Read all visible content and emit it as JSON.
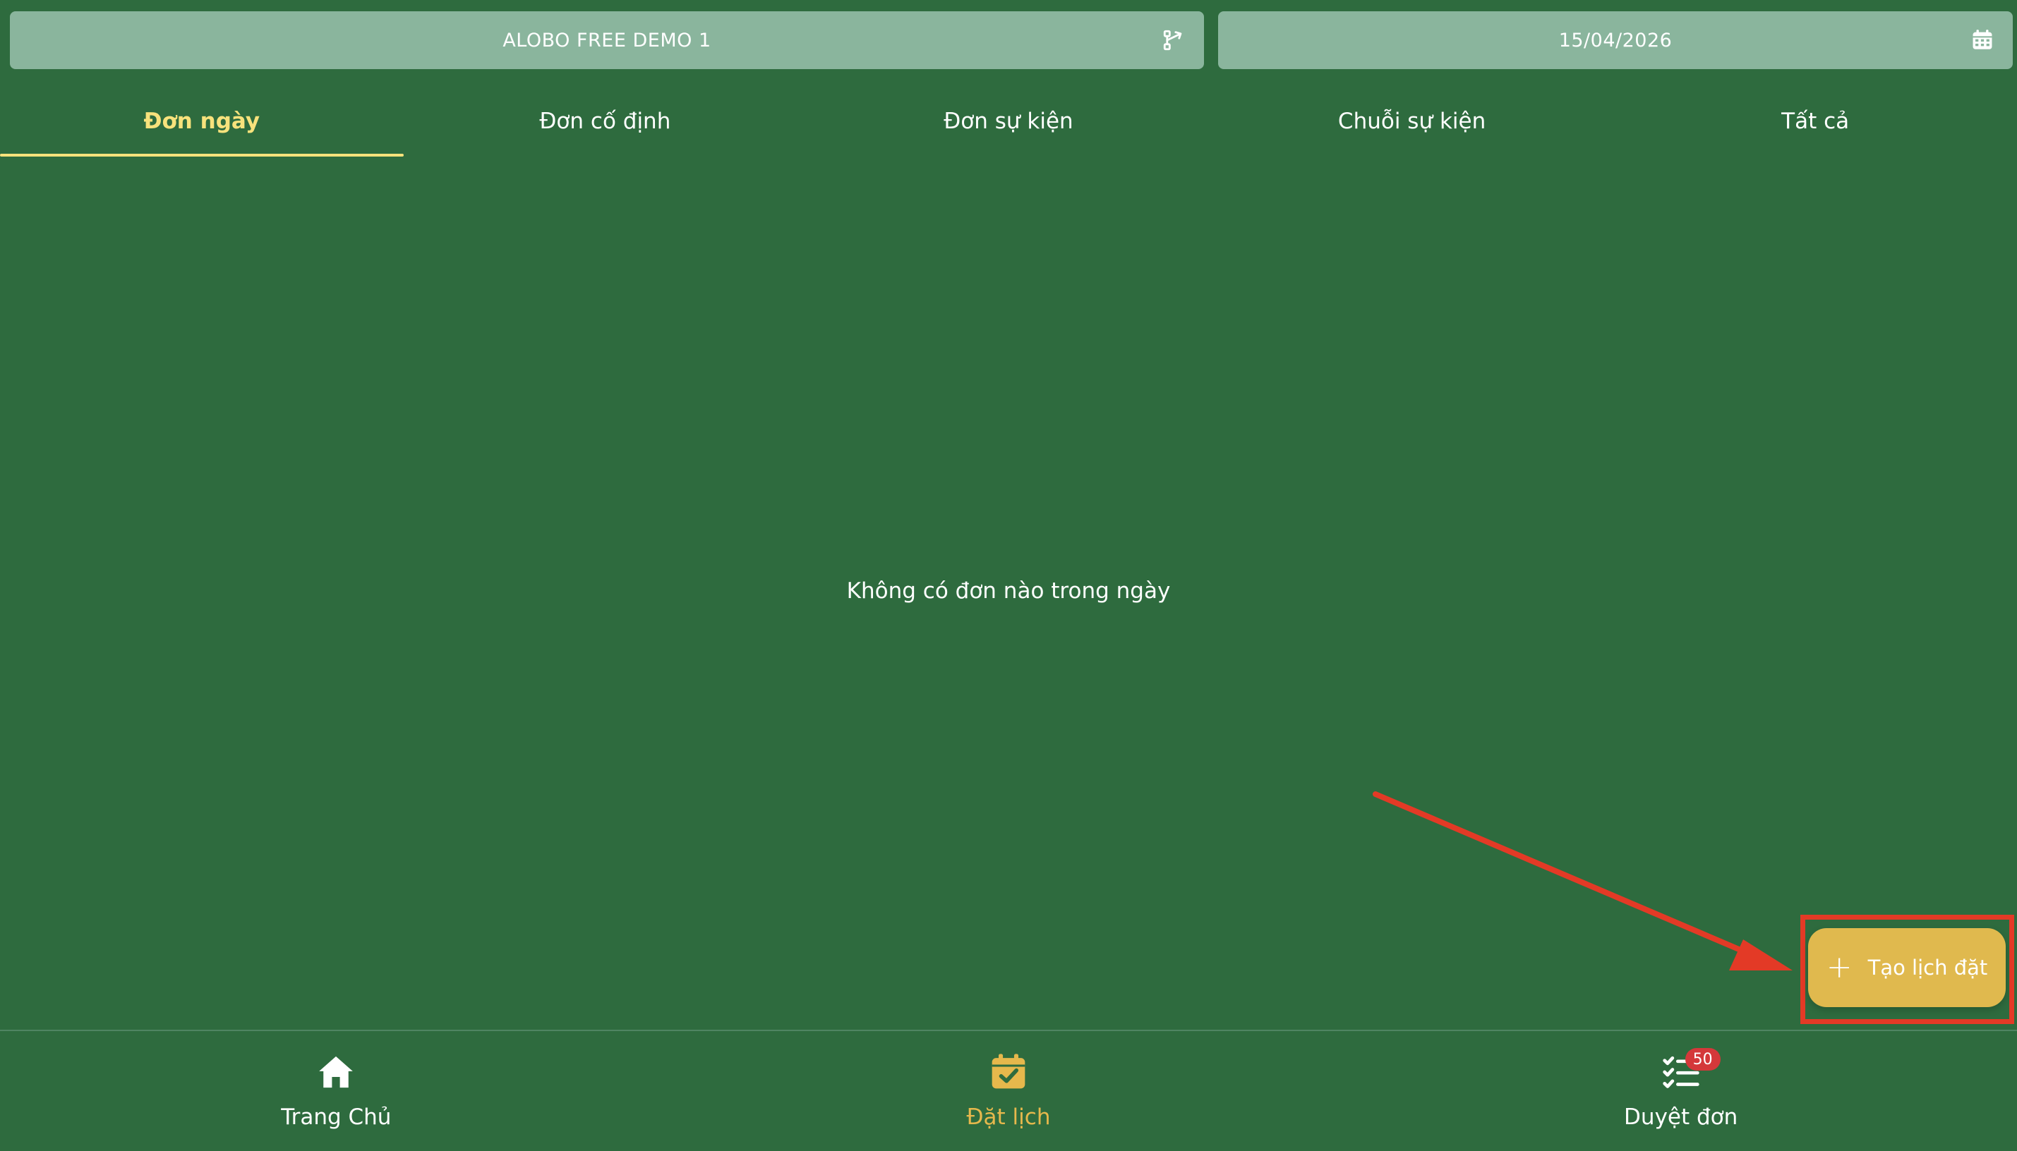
{
  "header": {
    "venue_name": "ALOBO FREE DEMO 1",
    "venue_icon": "branch-switch-icon",
    "date_value": "15/04/2026",
    "date_icon": "calendar-icon"
  },
  "tabs": [
    {
      "label": "Đơn ngày",
      "active": true
    },
    {
      "label": "Đơn cố định",
      "active": false
    },
    {
      "label": "Đơn sự kiện",
      "active": false
    },
    {
      "label": "Chuỗi sự kiện",
      "active": false
    },
    {
      "label": "Tất cả",
      "active": false
    }
  ],
  "main": {
    "empty_message": "Không có đơn nào trong ngày"
  },
  "fab": {
    "label": "Tạo lịch đặt",
    "icon": "plus-icon"
  },
  "bottom_nav": {
    "items": [
      {
        "label": "Trang Chủ",
        "icon": "home-icon",
        "active": false
      },
      {
        "label": "Đặt lịch",
        "icon": "calendar-check-icon",
        "active": true
      },
      {
        "label": "Duyệt đơn",
        "icon": "checklist-icon",
        "active": false,
        "badge": "50"
      }
    ]
  },
  "colors": {
    "background": "#2e6b3e",
    "selector_bg": "#8ab59d",
    "active_tab": "#f7e27c",
    "accent": "#e0b94e",
    "annotation": "#e33a26",
    "badge": "#d4383a"
  }
}
